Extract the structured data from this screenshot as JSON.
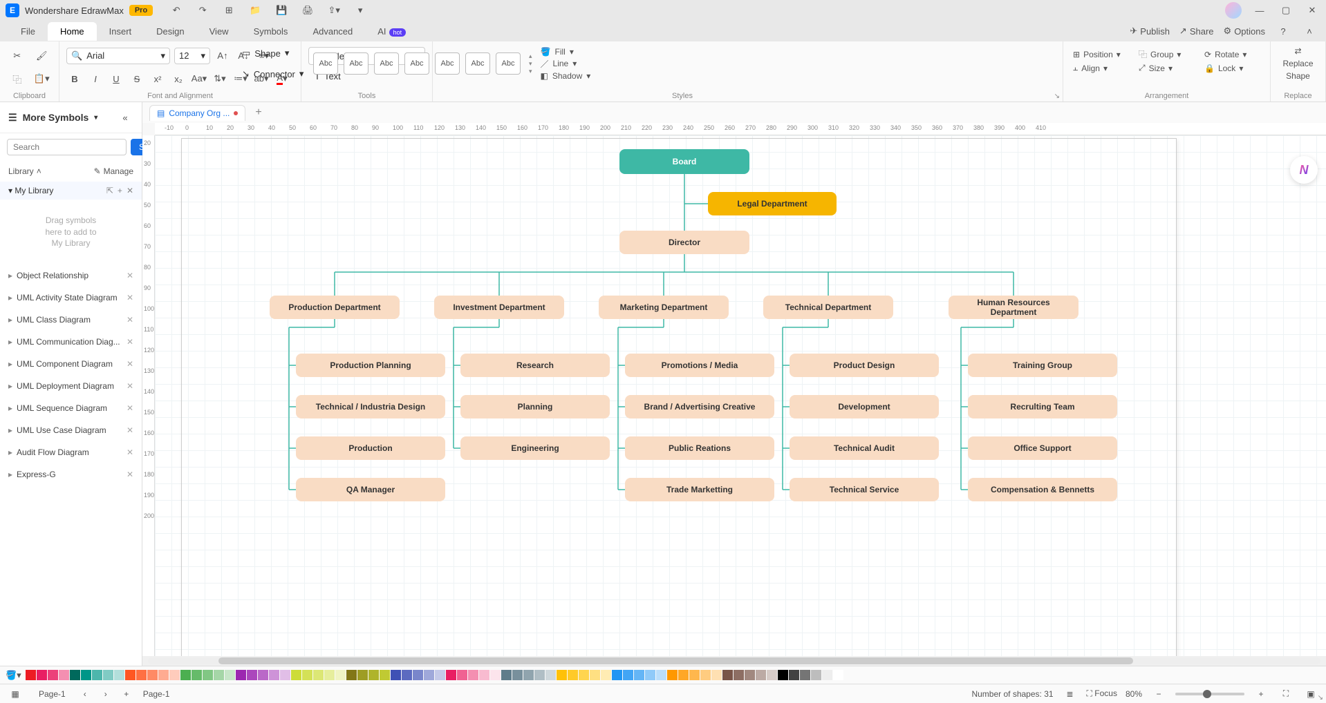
{
  "app": {
    "title": "Wondershare EdrawMax",
    "pro": "Pro"
  },
  "menus": [
    "File",
    "Home",
    "Insert",
    "Design",
    "View",
    "Symbols",
    "Advanced",
    "AI"
  ],
  "menu_active_index": 1,
  "menu_right": {
    "publish": "Publish",
    "share": "Share",
    "options": "Options"
  },
  "ribbon": {
    "clipboard_label": "Clipboard",
    "font_family": "Arial",
    "font_size": "12",
    "font_group_label": "Font and Alignment",
    "tools": {
      "select": "Select",
      "text": "Text",
      "shape": "Shape",
      "connector": "Connector",
      "label": "Tools"
    },
    "styles": {
      "swatch": "Abc",
      "label": "Styles",
      "fill": "Fill",
      "line": "Line",
      "shadow": "Shadow"
    },
    "arrangement": {
      "position": "Position",
      "group": "Group",
      "rotate": "Rotate",
      "align": "Align",
      "size": "Size",
      "lock": "Lock",
      "label": "Arrangement"
    },
    "replace": {
      "line1": "Replace",
      "line2": "Shape",
      "label": "Replace"
    }
  },
  "sidebar": {
    "title": "More Symbols",
    "search_placeholder": "Search",
    "search_btn": "Search",
    "library": "Library",
    "manage": "Manage",
    "my_library": "My Library",
    "dropzone": "Drag symbols\nhere to add to\nMy Library",
    "items": [
      "Object Relationship",
      "UML Activity State Diagram",
      "UML Class Diagram",
      "UML Communication Diag...",
      "UML Component Diagram",
      "UML Deployment Diagram",
      "UML Sequence Diagram",
      "UML Use Case Diagram",
      "Audit Flow Diagram",
      "Express-G"
    ]
  },
  "doc_tab": "Company Org ...",
  "org": {
    "board": "Board",
    "legal": "Legal  Department",
    "director": "Director",
    "depts": [
      "Production Department",
      "Investment Department",
      "Marketing Department",
      "Technical Department",
      "Human Resources Department"
    ],
    "c1": [
      "Production Planning",
      "Technical / Industria Design",
      "Production",
      "QA Manager"
    ],
    "c2": [
      "Research",
      "Planning",
      "Engineering"
    ],
    "c3": [
      "Promotions / Media",
      "Brand / Advertising Creative",
      "Public Reations",
      "Trade Marketting"
    ],
    "c4": [
      "Product Design",
      "Development",
      "Technical Audit",
      "Technical Service"
    ],
    "c5": [
      "Training Group",
      "Recrulting Team",
      "Office Support",
      "Compensation & Bennetts"
    ]
  },
  "ruler_h": [
    "-10",
    "0",
    "10",
    "20",
    "30",
    "40",
    "50",
    "60",
    "70",
    "80",
    "90",
    "100",
    "110",
    "120",
    "130",
    "140",
    "150",
    "160",
    "170",
    "180",
    "190",
    "200",
    "210",
    "220",
    "230",
    "240",
    "250",
    "260",
    "270",
    "280",
    "290",
    "300",
    "310",
    "320",
    "330",
    "340",
    "350",
    "360",
    "370",
    "380",
    "390",
    "400",
    "410"
  ],
  "ruler_v": [
    "20",
    "30",
    "40",
    "50",
    "60",
    "70",
    "80",
    "90",
    "100",
    "110",
    "120",
    "130",
    "140",
    "150",
    "160",
    "170",
    "180",
    "190",
    "200"
  ],
  "colors": [
    "#ed1c24",
    "#e91e63",
    "#ec407a",
    "#f48fb1",
    "#00695c",
    "#009688",
    "#4db6ac",
    "#80cbc4",
    "#b2dfdb",
    "#ff5722",
    "#ff7043",
    "#ff8a65",
    "#ffab91",
    "#ffccbc",
    "#4caf50",
    "#66bb6a",
    "#81c784",
    "#a5d6a7",
    "#c8e6c9",
    "#9c27b0",
    "#ab47bc",
    "#ba68c8",
    "#ce93d8",
    "#e1bee7",
    "#cddc39",
    "#d4e157",
    "#dce775",
    "#e6ee9c",
    "#f0f4c3",
    "#827717",
    "#9e9d24",
    "#afb42b",
    "#c0ca33",
    "#3f51b5",
    "#5c6bc0",
    "#7986cb",
    "#9fa8da",
    "#c5cae9",
    "#e91e63",
    "#f06292",
    "#f48fb1",
    "#f8bbd0",
    "#fce4ec",
    "#607d8b",
    "#78909c",
    "#90a4ae",
    "#b0bec5",
    "#cfd8dc",
    "#ffc107",
    "#ffca28",
    "#ffd54f",
    "#ffe082",
    "#ffecb3",
    "#2196f3",
    "#42a5f5",
    "#64b5f6",
    "#90caf9",
    "#bbdefb",
    "#ff9800",
    "#ffa726",
    "#ffb74d",
    "#ffcc80",
    "#ffe0b2",
    "#795548",
    "#8d6e63",
    "#a1887f",
    "#bcaaa4",
    "#d7ccc8",
    "#000000",
    "#424242",
    "#757575",
    "#bdbdbd",
    "#eeeeee",
    "#ffffff"
  ],
  "status": {
    "page_left": "Page-1",
    "page_right": "Page-1",
    "shapes": "Number of shapes: 31",
    "focus": "Focus",
    "zoom": "80%"
  }
}
